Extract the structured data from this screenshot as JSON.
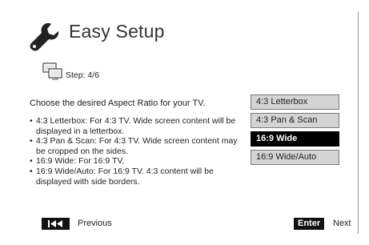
{
  "header": {
    "title": "Easy Setup",
    "icon": "wrench-icon"
  },
  "step": {
    "label": "Step: 4/6",
    "icon": "tv-screens-icon"
  },
  "prompt": "Choose the desired Aspect Ratio for your TV.",
  "descriptions": [
    "4:3 Letterbox: For 4:3 TV.  Wide screen content will be displayed in a letterbox.",
    "4:3 Pan & Scan: For 4:3 TV.  Wide screen content may be cropped on the sides.",
    "16:9 Wide: For 16:9 TV.",
    "16:9 Wide/Auto: For 16:9 TV.  4:3 content will be displayed with side borders."
  ],
  "options": [
    {
      "label": "4:3 Letterbox",
      "selected": false
    },
    {
      "label": "4:3 Pan & Scan",
      "selected": false
    },
    {
      "label": "16:9 Wide",
      "selected": true
    },
    {
      "label": "16:9 Wide/Auto",
      "selected": false
    }
  ],
  "footer": {
    "previous_label": "Previous",
    "previous_icon": "skip-back-icon",
    "enter_key": "Enter",
    "next_label": "Next"
  },
  "colors": {
    "option_bg": "#d4d4d4",
    "selected_bg": "#000000",
    "selected_text": "#ffffff"
  }
}
